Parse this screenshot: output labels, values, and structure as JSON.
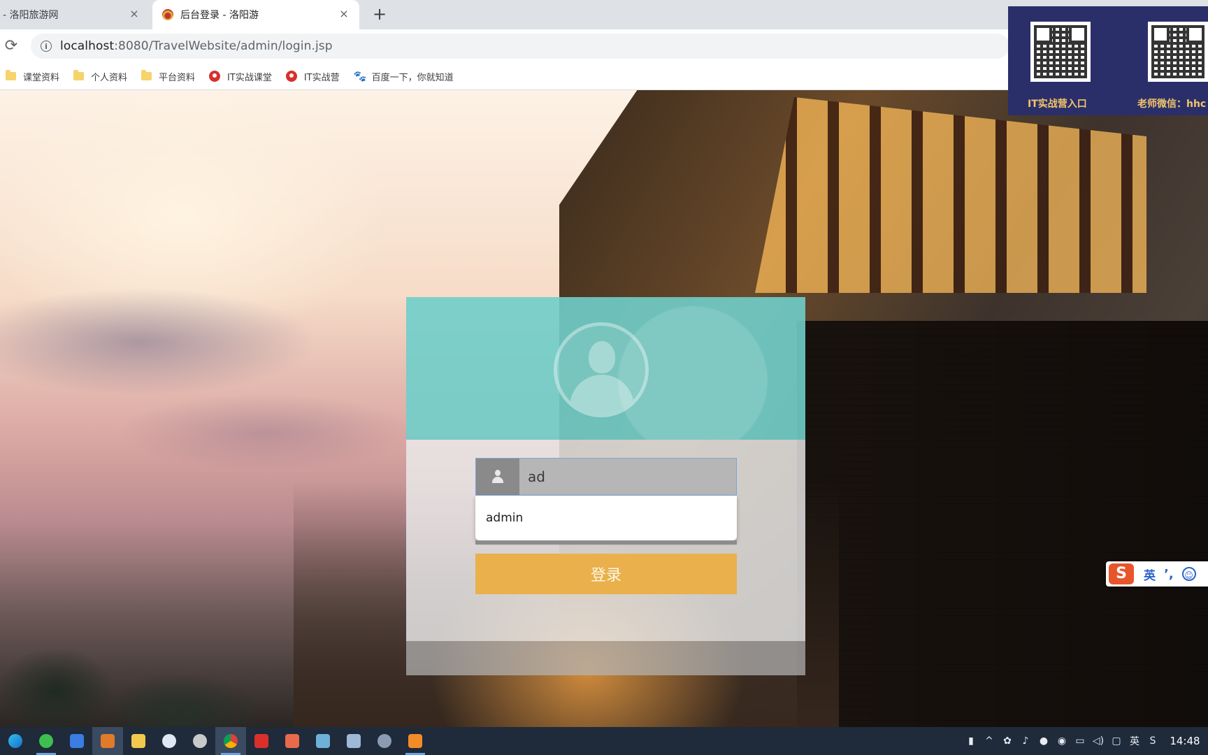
{
  "browser": {
    "tabs": [
      {
        "title": "- 洛阳旅游网",
        "active": false
      },
      {
        "title": "后台登录 - 洛阳游",
        "active": true
      }
    ],
    "close_glyph": "×",
    "newtab_glyph": "+",
    "url_host": "localhost",
    "url_rest": ":8080/TravelWebsite/admin/login.jsp",
    "bookmarks": [
      {
        "label": "课堂资料",
        "icon": "folder-icon"
      },
      {
        "label": "个人资料",
        "icon": "folder-icon"
      },
      {
        "label": "平台资料",
        "icon": "folder-icon"
      },
      {
        "label": "IT实战课堂",
        "icon": "shield-icon"
      },
      {
        "label": "IT实战营",
        "icon": "shield-icon"
      },
      {
        "label": "百度一下，你就知道",
        "icon": "paw-icon"
      }
    ]
  },
  "login": {
    "username_value": "ad",
    "autocomplete_option": "admin",
    "button_label": "登录"
  },
  "overlay": {
    "qr_labels": [
      "IT实战营入口",
      "老师微信：hhc"
    ]
  },
  "ime": {
    "logo": "S",
    "lang": "英",
    "punct": "’,",
    "smile": "☺"
  },
  "taskbar": {
    "tray_lang": "英",
    "clock": "14:48"
  },
  "colors": {
    "card_header": "#70ceca",
    "login_button": "#e9b04b",
    "qr_panel": "#2a2f6a",
    "taskbar": "#1f2a3a"
  }
}
